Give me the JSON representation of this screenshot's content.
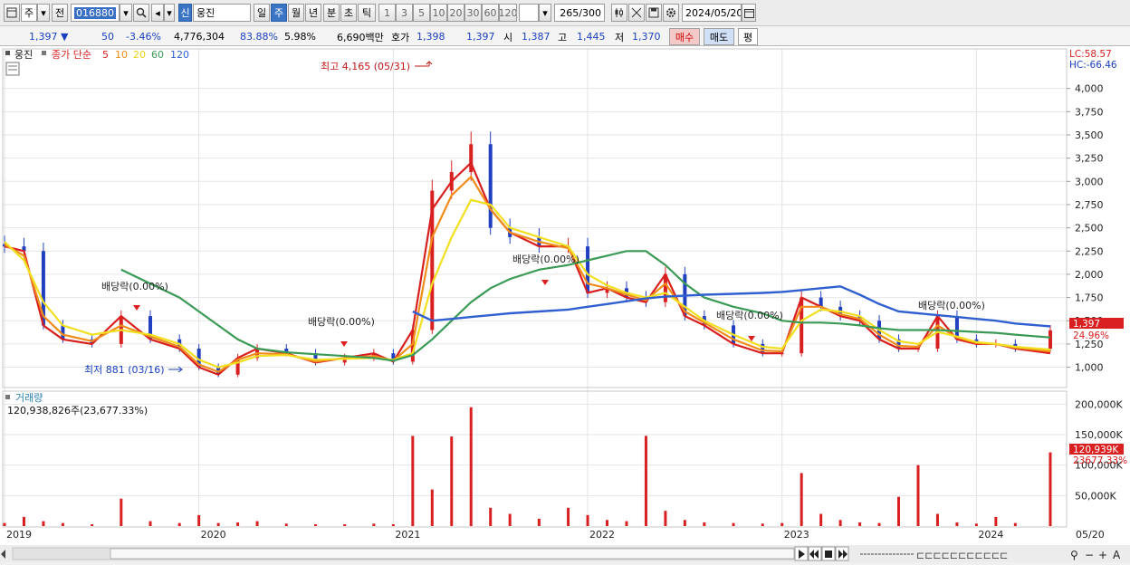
{
  "toolbar": {
    "period_label": "주",
    "prev_label": "전",
    "stock_code": "016880",
    "new_badge": "신",
    "stock_name": "웅진",
    "tabs": [
      "일",
      "주",
      "월",
      "년",
      "분",
      "초",
      "틱"
    ],
    "active_tab": "주",
    "intervals": [
      "1",
      "3",
      "5",
      "10",
      "20",
      "30",
      "60",
      "120"
    ],
    "count_display": "265",
    "count_max": "/300",
    "date": "2024/05/20"
  },
  "quote": {
    "price": "1,397",
    "change_dir": "▼",
    "change": "50",
    "change_pct": "-3.46%",
    "volume": "4,776,304",
    "vol_ratio": "83.88%",
    "turnover": "5.98%",
    "amount": "6,690백만",
    "ask_label": "호가",
    "ask": "1,398",
    "bid": "1,397",
    "open_label": "시",
    "open": "1,387",
    "high_label": "고",
    "high": "1,445",
    "low_label": "저",
    "low": "1,370",
    "buy_label": "매수",
    "sell_label": "매도",
    "eval_label": "평"
  },
  "legend": {
    "name": "웅진",
    "ma_label": "종가 단순",
    "periods": [
      "5",
      "10",
      "20",
      "60",
      "120"
    ]
  },
  "colors": {
    "up": "#d92020",
    "down": "#2040c0",
    "ma5": "#d81e1e",
    "ma10": "#f08c1a",
    "ma20": "#f2e020",
    "ma60": "#3a9a56",
    "ma120": "#3060d0",
    "volume_bar": "#d92020"
  },
  "right_info": {
    "lc": "LC:58.57",
    "hc": "HC:-66.46",
    "price_tag": "1,397",
    "pct_tag": "24.96%",
    "vol_tag": "120,939K",
    "vol_pct_tag": "23677.33%"
  },
  "volume_panel": {
    "title": "거래량",
    "summary": "120,938,826주(23,677.33%)"
  },
  "annotations": {
    "high": "최고 4,165 (05/31)",
    "low": "최저 881 (03/16)",
    "dividends": [
      "배당락(0.00%)",
      "배당락(0.00%)",
      "배당락(0.00%)",
      "배당락(0.00%)",
      "배당락(0.00%)"
    ]
  },
  "x_labels": [
    "2019",
    "2020",
    "2021",
    "2022",
    "2023",
    "2024",
    "05/20"
  ],
  "price_ticks": [
    "4,000",
    "3,750",
    "3,500",
    "3,250",
    "3,000",
    "2,750",
    "2,500",
    "2,250",
    "2,000",
    "1,750",
    "1,500",
    "1,250",
    "1,000"
  ],
  "volume_ticks": [
    "200,000K",
    "150,000K",
    "100,000K",
    "50,000K"
  ],
  "chart_data": {
    "type": "line",
    "title": "",
    "ylim": [
      830,
      4260
    ],
    "x": [
      2019.0,
      2019.1,
      2019.2,
      2019.3,
      2019.45,
      2019.6,
      2019.75,
      2019.9,
      2020.0,
      2020.1,
      2020.2,
      2020.3,
      2020.45,
      2020.6,
      2020.75,
      2020.9,
      2021.0,
      2021.1,
      2021.2,
      2021.3,
      2021.4,
      2021.5,
      2021.6,
      2021.75,
      2021.9,
      2022.0,
      2022.1,
      2022.2,
      2022.3,
      2022.4,
      2022.5,
      2022.6,
      2022.75,
      2022.9,
      2023.0,
      2023.1,
      2023.2,
      2023.3,
      2023.4,
      2023.5,
      2023.6,
      2023.7,
      2023.8,
      2023.9,
      2024.0,
      2024.1,
      2024.2,
      2024.38
    ],
    "series": [
      {
        "name": "5",
        "values": [
          2300,
          2250,
          1450,
          1300,
          1250,
          1550,
          1300,
          1200,
          1000,
          920,
          1100,
          1200,
          1150,
          1050,
          1100,
          1150,
          1060,
          1400,
          2700,
          3000,
          3200,
          2700,
          2450,
          2300,
          2300,
          1800,
          1850,
          1750,
          1700,
          2000,
          1550,
          1450,
          1250,
          1150,
          1150,
          1750,
          1650,
          1550,
          1500,
          1300,
          1200,
          1200,
          1550,
          1300,
          1250,
          1250,
          1200,
          1150
        ]
      },
      {
        "name": "10",
        "values": [
          2320,
          2200,
          1550,
          1350,
          1280,
          1450,
          1330,
          1220,
          1030,
          950,
          1080,
          1150,
          1140,
          1060,
          1100,
          1120,
          1070,
          1250,
          2400,
          2850,
          3050,
          2700,
          2450,
          2350,
          2280,
          1900,
          1850,
          1780,
          1720,
          1900,
          1600,
          1480,
          1300,
          1180,
          1170,
          1650,
          1650,
          1570,
          1520,
          1350,
          1230,
          1220,
          1450,
          1320,
          1260,
          1250,
          1210,
          1170
        ]
      },
      {
        "name": "20",
        "values": [
          2350,
          2150,
          1700,
          1450,
          1350,
          1400,
          1350,
          1250,
          1080,
          1000,
          1050,
          1120,
          1130,
          1080,
          1090,
          1100,
          1080,
          1150,
          1900,
          2400,
          2800,
          2750,
          2500,
          2400,
          2300,
          2000,
          1880,
          1800,
          1750,
          1800,
          1650,
          1500,
          1350,
          1220,
          1200,
          1500,
          1620,
          1600,
          1550,
          1400,
          1280,
          1250,
          1380,
          1330,
          1270,
          1250,
          1220,
          1190
        ]
      },
      {
        "name": "60",
        "values": [
          null,
          null,
          null,
          null,
          null,
          2050,
          1900,
          1750,
          1600,
          1450,
          1300,
          1200,
          1160,
          1140,
          1120,
          1100,
          1070,
          1130,
          1300,
          1500,
          1700,
          1850,
          1950,
          2050,
          2100,
          2150,
          2200,
          2250,
          2250,
          2100,
          1900,
          1750,
          1650,
          1580,
          1500,
          1480,
          1480,
          1470,
          1450,
          1420,
          1400,
          1400,
          1400,
          1390,
          1380,
          1370,
          1350,
          1320
        ]
      },
      {
        "name": "120",
        "values": [
          null,
          null,
          null,
          null,
          null,
          null,
          null,
          null,
          null,
          null,
          null,
          null,
          null,
          null,
          null,
          null,
          null,
          1600,
          1500,
          1520,
          1540,
          1560,
          1580,
          1600,
          1620,
          1650,
          1680,
          1710,
          1740,
          1760,
          1770,
          1780,
          1790,
          1800,
          1810,
          1830,
          1850,
          1870,
          1780,
          1680,
          1600,
          1580,
          1560,
          1540,
          1520,
          1500,
          1470,
          1440
        ]
      }
    ],
    "close": [
      2300,
      2250,
      1450,
      1300,
      1250,
      1550,
      1300,
      1200,
      1000,
      920,
      1100,
      1200,
      1150,
      1050,
      1100,
      1150,
      1060,
      1400,
      2900,
      3100,
      3400,
      2500,
      2400,
      2300,
      2300,
      1800,
      1850,
      1750,
      1700,
      2000,
      1550,
      1450,
      1250,
      1150,
      1150,
      1750,
      1650,
      1550,
      1500,
      1300,
      1200,
      1200,
      1550,
      1300,
      1250,
      1250,
      1200,
      1397
    ],
    "volume_k": [
      5000,
      15000,
      8000,
      5000,
      3000,
      45000,
      8000,
      5000,
      18000,
      5000,
      6000,
      8000,
      4000,
      3000,
      3000,
      4000,
      3000,
      148000,
      60000,
      147000,
      195000,
      30000,
      20000,
      12000,
      30000,
      18000,
      10000,
      8000,
      148000,
      25000,
      10000,
      6000,
      5000,
      4000,
      5000,
      87000,
      20000,
      10000,
      6000,
      5000,
      48000,
      100000,
      20000,
      6000,
      4000,
      15000,
      5000,
      120939
    ]
  }
}
